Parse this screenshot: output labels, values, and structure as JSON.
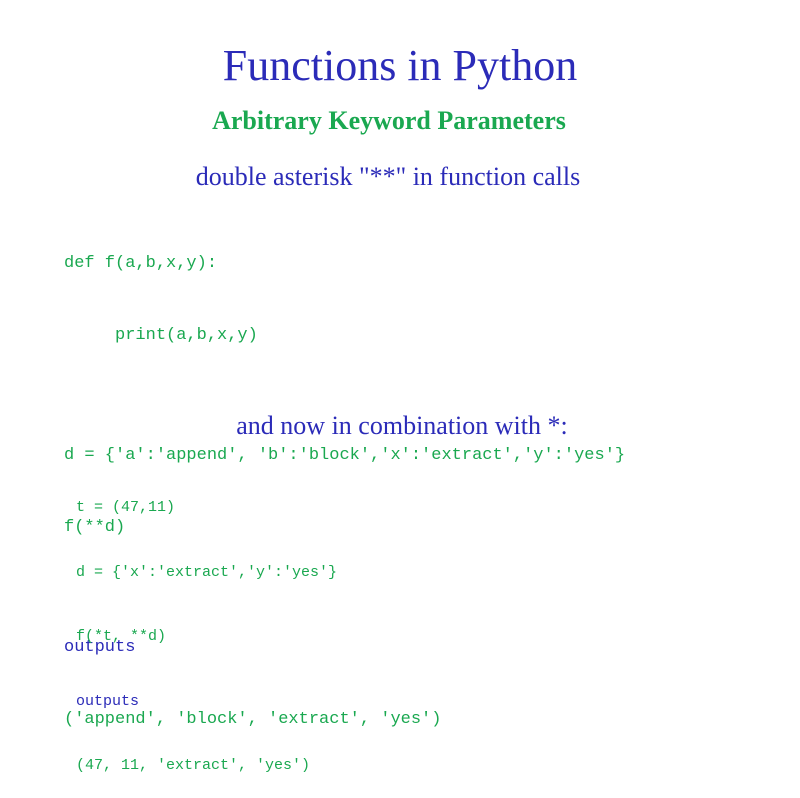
{
  "slide": {
    "title": "Functions in Python",
    "subtitle": "Arbitrary Keyword Parameters",
    "heading1": "double asterisk \"**\" in function calls",
    "heading2": "and now in combination with *:"
  },
  "code1": {
    "lines": [
      "def f(a,b,x,y):",
      "     print(a,b,x,y)",
      "",
      "d = {'a':'append', 'b':'block','x':'extract','y':'yes'}",
      "f(**d)",
      "",
      "outputs",
      "('append', 'block', 'extract', 'yes')"
    ]
  },
  "code2": {
    "lines": [
      "t = (47,11)",
      "d = {'x':'extract','y':'yes'}",
      "f(*t, **d)",
      "outputs",
      "(47, 11, 'extract', 'yes')"
    ]
  },
  "colors": {
    "title_blue": "#2b2bb8",
    "code_green": "#1aa850"
  }
}
